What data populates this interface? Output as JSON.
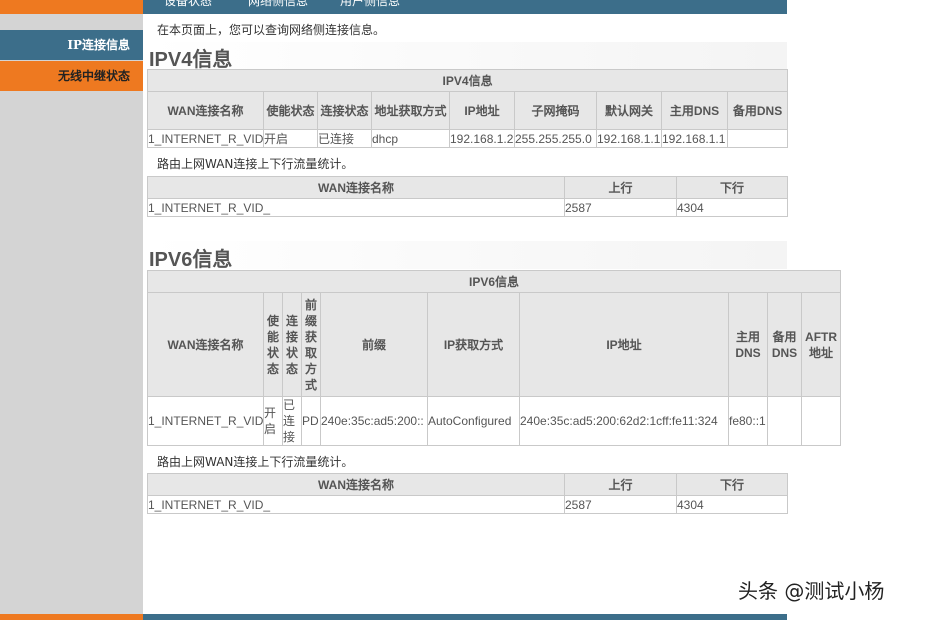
{
  "top_nav": {
    "tabs": [
      "设备状态",
      "网络侧信息",
      "用户侧信息"
    ]
  },
  "sidebar": {
    "items": [
      {
        "label": "IP连接信息"
      },
      {
        "label": "无线中继状态"
      }
    ]
  },
  "page": {
    "description": "在本页面上，您可以查询网络侧连接信息。"
  },
  "ipv4": {
    "heading": "IPV4信息",
    "table_caption": "IPV4信息",
    "columns": [
      "WAN连接名称",
      "使能状态",
      "连接状态",
      "地址获取方式",
      "IP地址",
      "子网掩码",
      "默认网关",
      "主用DNS",
      "备用DNS"
    ],
    "rows": [
      [
        "1_INTERNET_R_VID_",
        "开启",
        "已连接",
        "dhcp",
        "192.168.1.2",
        "255.255.255.0",
        "192.168.1.1",
        "192.168.1.1",
        ""
      ]
    ],
    "traffic_note": "路由上网WAN连接上下行流量统计。",
    "traffic_columns": [
      "WAN连接名称",
      "上行",
      "下行"
    ],
    "traffic_rows": [
      [
        "1_INTERNET_R_VID_",
        "2587",
        "4304"
      ]
    ]
  },
  "ipv6": {
    "heading": "IPV6信息",
    "table_caption": "IPV6信息",
    "columns": [
      "WAN连接名称",
      "使能状态",
      "连接状态",
      "前缀获取方式",
      "前缀",
      "IP获取方式",
      "IP地址",
      "主用DNS",
      "备用DNS",
      "AFTR地址"
    ],
    "rows": [
      [
        "1_INTERNET_R_VID_",
        "开启",
        "已连接",
        "PD",
        "240e:35c:ad5:200::",
        "AutoConfigured",
        "240e:35c:ad5:200:62d2:1cff:fe11:324",
        "fe80::1",
        "",
        ""
      ]
    ],
    "traffic_note": "路由上网WAN连接上下行流量统计。",
    "traffic_columns": [
      "WAN连接名称",
      "上行",
      "下行"
    ],
    "traffic_rows": [
      [
        "1_INTERNET_R_VID_",
        "2587",
        "4304"
      ]
    ]
  },
  "watermark": "头条 @测试小杨",
  "colors": {
    "nav_blue": "#3c6e8a",
    "accent_orange": "#ee7920",
    "sidebar_gray": "#d4d4d4",
    "header_gray": "#e7e7e7"
  }
}
